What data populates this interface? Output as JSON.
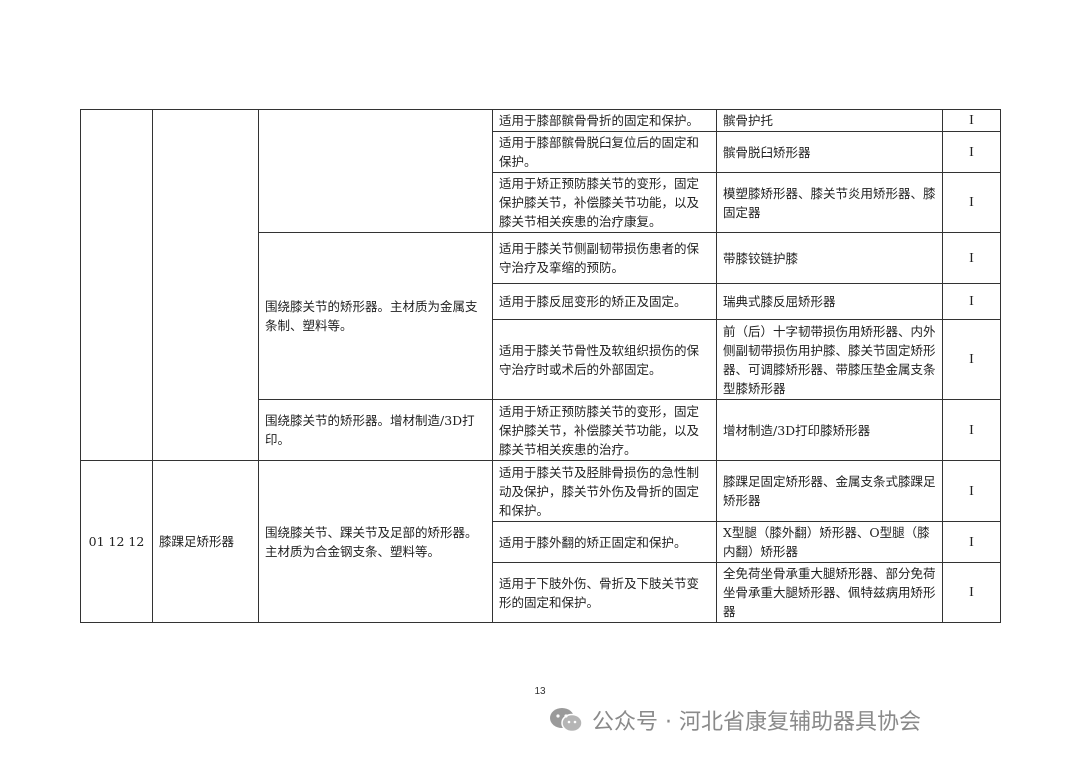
{
  "table": {
    "rows": [
      {
        "suit": "适用于膝部髌骨骨折的固定和保护。",
        "product": "髌骨护托",
        "grade": "I"
      },
      {
        "suit": "适用于膝部髌骨脱臼复位后的固定和保护。",
        "product": "髌骨脱臼矫形器",
        "grade": "I"
      },
      {
        "suit": "适用于矫正预防膝关节的变形，固定保护膝关节，补偿膝关节功能，以及膝关节相关疾患的治疗康复。",
        "product": "模塑膝矫形器、膝关节炎用矫形器、膝固定器",
        "grade": "I"
      },
      {
        "desc": "围绕膝关节的矫形器。主材质为金属支条制、塑料等。",
        "suit": "适用于膝关节侧副韧带损伤患者的保守治疗及挛缩的预防。",
        "product": "带膝铰链护膝",
        "grade": "I"
      },
      {
        "suit": "适用于膝反屈变形的矫正及固定。",
        "product": "瑞典式膝反屈矫形器",
        "grade": "I"
      },
      {
        "suit": "适用于膝关节骨性及软组织损伤的保守治疗时或术后的外部固定。",
        "product": "前（后）十字韧带损伤用矫形器、内外侧副韧带损伤用护膝、膝关节固定矫形器、可调膝矫形器、带膝压垫金属支条型膝矫形器",
        "grade": "I"
      },
      {
        "desc": "围绕膝关节的矫形器。增材制造/3D打印。",
        "suit": "适用于矫正预防膝关节的变形，固定保护膝关节，补偿膝关节功能，以及膝关节相关疾患的治疗。",
        "product": "增材制造/3D打印膝矫形器",
        "grade": "I"
      },
      {
        "code": "01 12 12",
        "name": "膝踝足矫形器",
        "desc": "围绕膝关节、踝关节及足部的矫形器。主材质为合金钢支条、塑料等。",
        "suit": "适用于膝关节及胫腓骨损伤的急性制动及保护，膝关节外伤及骨折的固定和保护。",
        "product": "膝踝足固定矫形器、金属支条式膝踝足矫形器",
        "grade": "I"
      },
      {
        "suit": "适用于膝外翻的矫正固定和保护。",
        "product": "X型腿（膝外翻）矫形器、O型腿（膝内翻）矫形器",
        "grade": "I"
      },
      {
        "suit": "适用于下肢外伤、骨折及下肢关节变形的固定和保护。",
        "product": "全免荷坐骨承重大腿矫形器、部分免荷坐骨承重大腿矫形器、佩特兹病用矫形器",
        "grade": "I"
      }
    ]
  },
  "page_number": "13",
  "watermark": {
    "text": "公众号 · 河北省康复辅助器具协会",
    "icon": "wechat-icon"
  }
}
